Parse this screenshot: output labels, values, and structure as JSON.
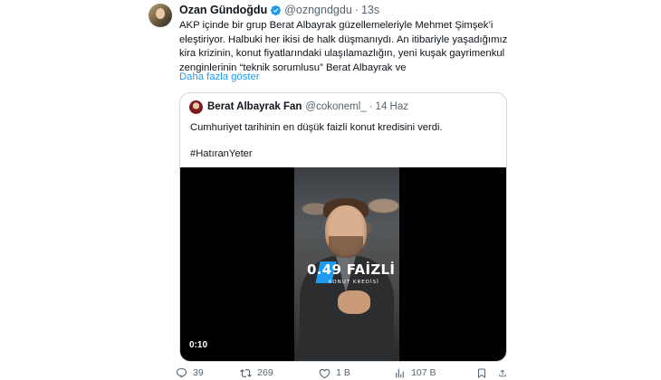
{
  "tweet": {
    "author_name": "Ozan Gündoğdu",
    "handle": "@ozngndgdu",
    "time": "13s",
    "body_lines": [
      "AKP içinde bir grup Berat Albayrak güzellemeleriyle Mehmet Şimşek’i",
      "eleştiriyor. Halbuki her ikisi de halk düşmanıydı. An itibariyle yaşadığımız",
      "kira krizinin, konut fiyatlarındaki ulaşılamazlığın, yeni kuşak gayrimenkul",
      "zenginlerinin “teknik sorumlusu” Berat Albayrak ve"
    ],
    "show_more": "Daha fazla göster"
  },
  "quote": {
    "author_name": "Berat Albayrak Fan",
    "handle": "@cokoneml_",
    "date": "14 Haz",
    "text": "Cumhuriyet tarihinin en düşük faizli konut kredisini verdi.",
    "hashtag": "#HatıranYeter",
    "video": {
      "overlay_big": "0.49 FAİZLİ",
      "overlay_small": "KONUT KREDİSİ",
      "duration": "0:10"
    }
  },
  "actions": {
    "replies": "39",
    "retweets": "269",
    "likes": "1 B",
    "views": "107 B"
  },
  "colors": {
    "accent": "#1d9bf0",
    "text": "#0f1419",
    "muted": "#536471",
    "border": "#cfd9de"
  }
}
